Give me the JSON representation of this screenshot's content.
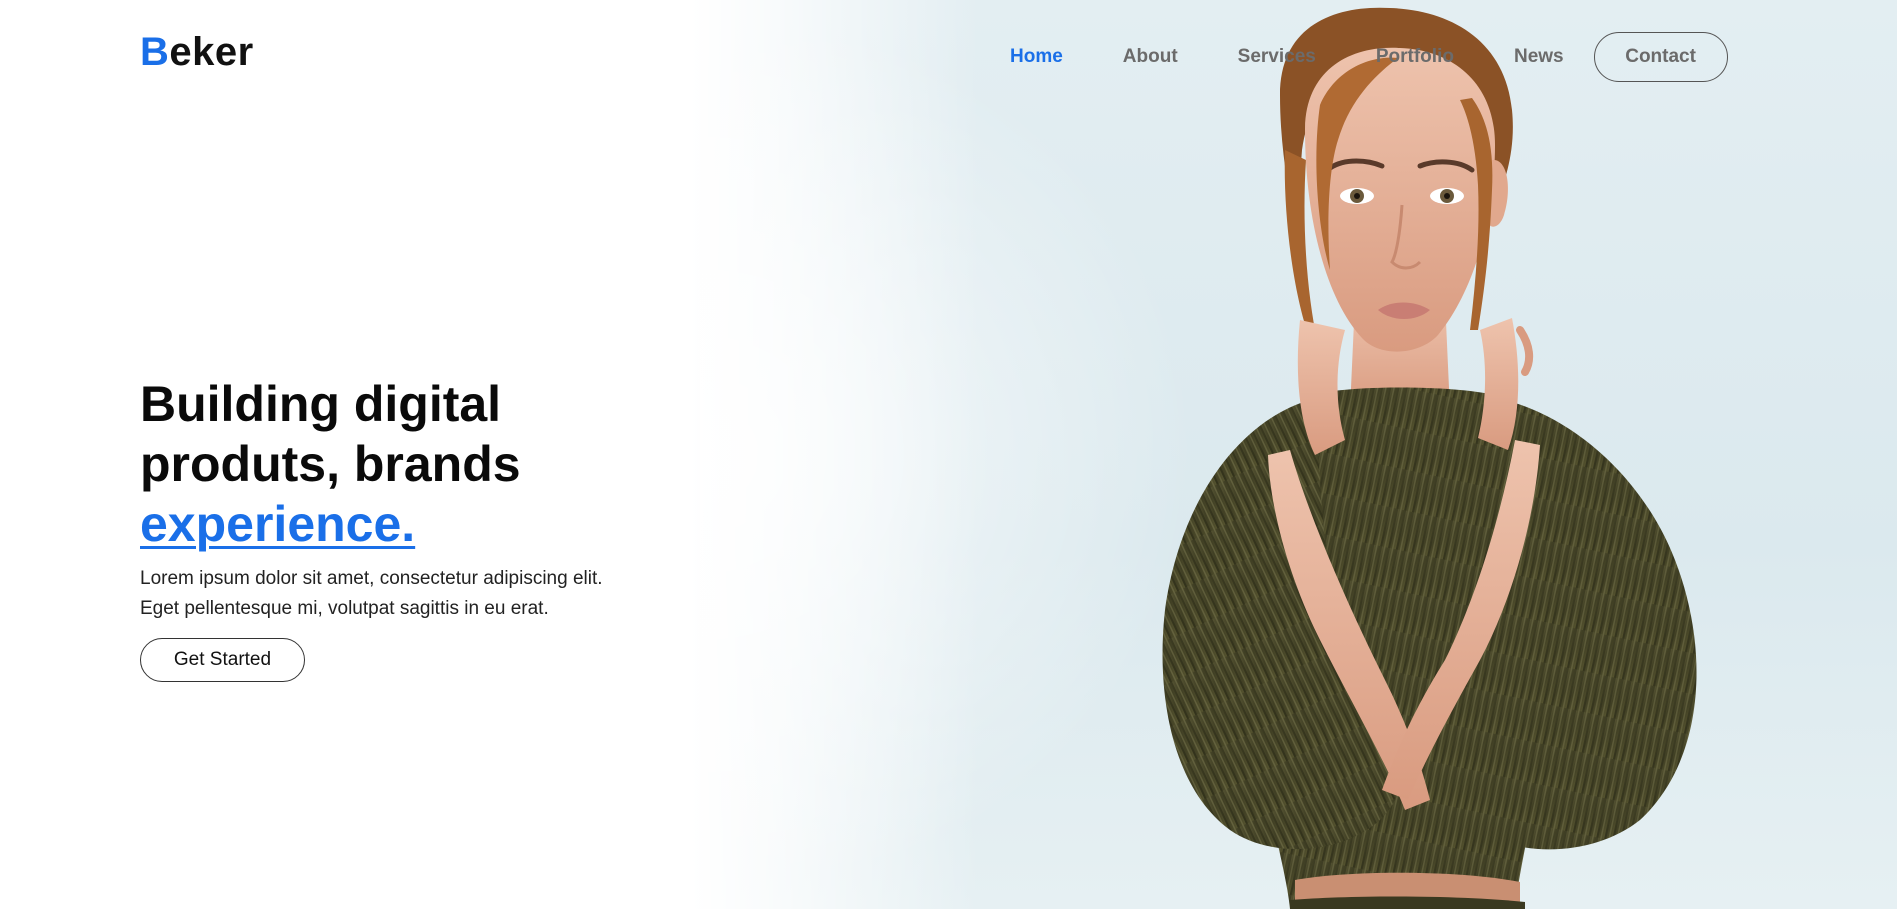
{
  "brand": {
    "logo_initial": "B",
    "logo_rest": "eker",
    "accent_color": "#1a6fe8"
  },
  "nav": {
    "items": [
      {
        "label": "Home",
        "active": true
      },
      {
        "label": "About",
        "active": false
      },
      {
        "label": "Services",
        "active": false
      },
      {
        "label": "Portfolio",
        "active": false
      },
      {
        "label": "News",
        "active": false
      }
    ],
    "contact_label": "Contact"
  },
  "hero": {
    "title_line1": "Building digital",
    "title_line2": "produts, brands",
    "title_accent": "experience.",
    "description": "Lorem ipsum dolor sit amet, consectetur adipiscing elit. Eget pellentesque mi, volutpat sagittis in eu erat.",
    "cta_label": "Get Started"
  },
  "colors": {
    "background_right": "#dbe9ee",
    "text_primary": "#0a0a0a",
    "nav_text": "#6b6b6b",
    "dress": "#4b4a2e",
    "skin": "#e8b9a2",
    "hair": "#a8652f"
  }
}
